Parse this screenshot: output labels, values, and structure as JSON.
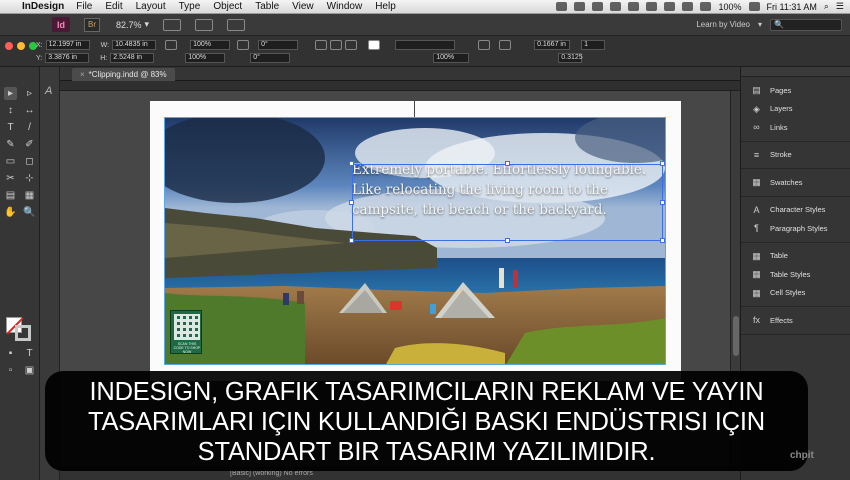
{
  "menubar": {
    "apple": "",
    "app_name": "InDesign",
    "items": [
      "File",
      "Edit",
      "Layout",
      "Type",
      "Object",
      "Table",
      "View",
      "Window",
      "Help"
    ],
    "battery": "100%",
    "clock": "Fri 11:31 AM"
  },
  "appbar": {
    "id_logo": "Id",
    "br_logo": "Br",
    "zoom": "82.7%",
    "workspace": "Learn by Video",
    "search_placeholder": "🔍"
  },
  "control": {
    "x_label": "X:",
    "x_value": "12.1997 in",
    "y_label": "Y:",
    "y_value": "3.3876 in",
    "w_label": "W:",
    "w_value": "10.4835 in",
    "h_label": "H:",
    "h_value": "2.5248 in",
    "scale_x": "100%",
    "scale_y": "100%",
    "angle": "0°",
    "shear": "0°",
    "opacity": "100%",
    "stroke_weight": "0.1667 in",
    "columns": "1",
    "gutter": "0.3125",
    "colors": {
      "red": "#ff5f57",
      "yellow": "#febc2e",
      "green": "#28c840"
    }
  },
  "document": {
    "tab_title": "*Clipping.indd @ 83%",
    "close_glyph": "×"
  },
  "canvas": {
    "text_lines": [
      "Extremely portable. Effortlessly loungable.",
      "Like relocating the living room to the",
      "campsite, the beach or the backyard."
    ],
    "qr_caption": "SCAN THIS CODE TO SHOP NOW"
  },
  "tools": [
    "▸",
    "▹",
    "↕",
    "↔",
    "T",
    "/",
    "✎",
    "✐",
    "▭",
    "◻",
    "✂",
    "⊹",
    "▤",
    "▦",
    "✋",
    "🔍",
    "▪",
    "T",
    "▫",
    "▣"
  ],
  "panels": {
    "group1": [
      {
        "icon": "▤",
        "label": "Pages"
      },
      {
        "icon": "◈",
        "label": "Layers"
      },
      {
        "icon": "∞",
        "label": "Links"
      }
    ],
    "group2": [
      {
        "icon": "≡",
        "label": "Stroke"
      }
    ],
    "group3": [
      {
        "icon": "▦",
        "label": "Swatches"
      }
    ],
    "group4": [
      {
        "icon": "A",
        "label": "Character Styles"
      },
      {
        "icon": "¶",
        "label": "Paragraph Styles"
      }
    ],
    "group5": [
      {
        "icon": "▦",
        "label": "Table"
      },
      {
        "icon": "▦",
        "label": "Table Styles"
      },
      {
        "icon": "▦",
        "label": "Cell Styles"
      }
    ],
    "group6": [
      {
        "icon": "fx",
        "label": "Effects"
      }
    ]
  },
  "status": {
    "text": "[Basic] (working)     No errors"
  },
  "subtitle": {
    "lines": [
      "INDESIGN, GRAFIK TASARIMCILARIN REKLAM VE YAYIN",
      "TASARIMLARI IÇIN KULLANDIĞI BASKI ENDÜSTRISI IÇIN",
      "STANDART BIR TASARIM YAZILIMIDIR."
    ]
  },
  "watermark": "chpit"
}
